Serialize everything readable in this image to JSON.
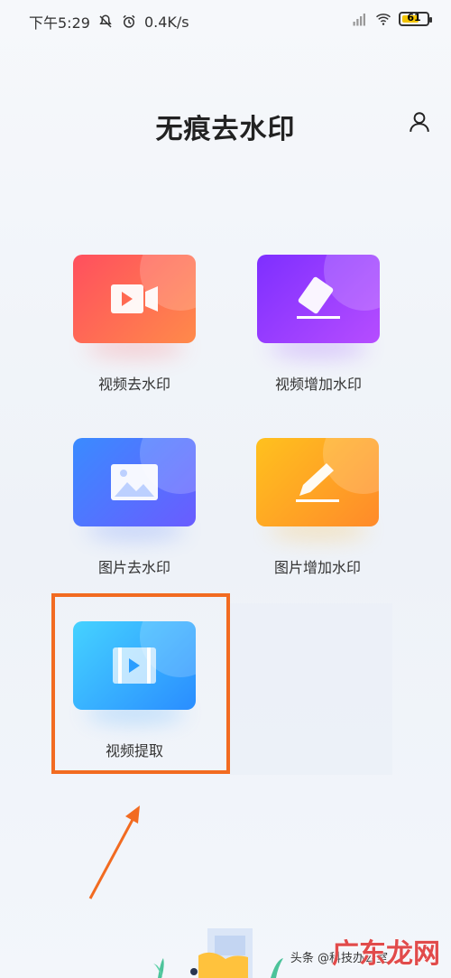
{
  "status_bar": {
    "time": "下午5:29",
    "speed": "0.4K/s",
    "battery": "61"
  },
  "header": {
    "title": "无痕去水印"
  },
  "features": [
    {
      "label": "视频去水印",
      "icon": "video-camera-icon",
      "colors": [
        "#ff5a5f",
        "#ff8a4a"
      ]
    },
    {
      "label": "视频增加水印",
      "icon": "eraser-icon",
      "colors": [
        "#8e3cff",
        "#b64dff"
      ]
    },
    {
      "label": "图片去水印",
      "icon": "image-icon",
      "colors": [
        "#4a78ff",
        "#6a5cff"
      ]
    },
    {
      "label": "图片增加水印",
      "icon": "pencil-icon",
      "colors": [
        "#ffb21e",
        "#ff8a2a"
      ]
    },
    {
      "label": "视频提取",
      "icon": "video-extract-icon",
      "colors": [
        "#3cc9ff",
        "#2a9dff"
      ]
    }
  ],
  "highlight_color": "#f26b21",
  "watermark": {
    "text": "广东龙网",
    "sub": "头条 @科技办公室"
  }
}
